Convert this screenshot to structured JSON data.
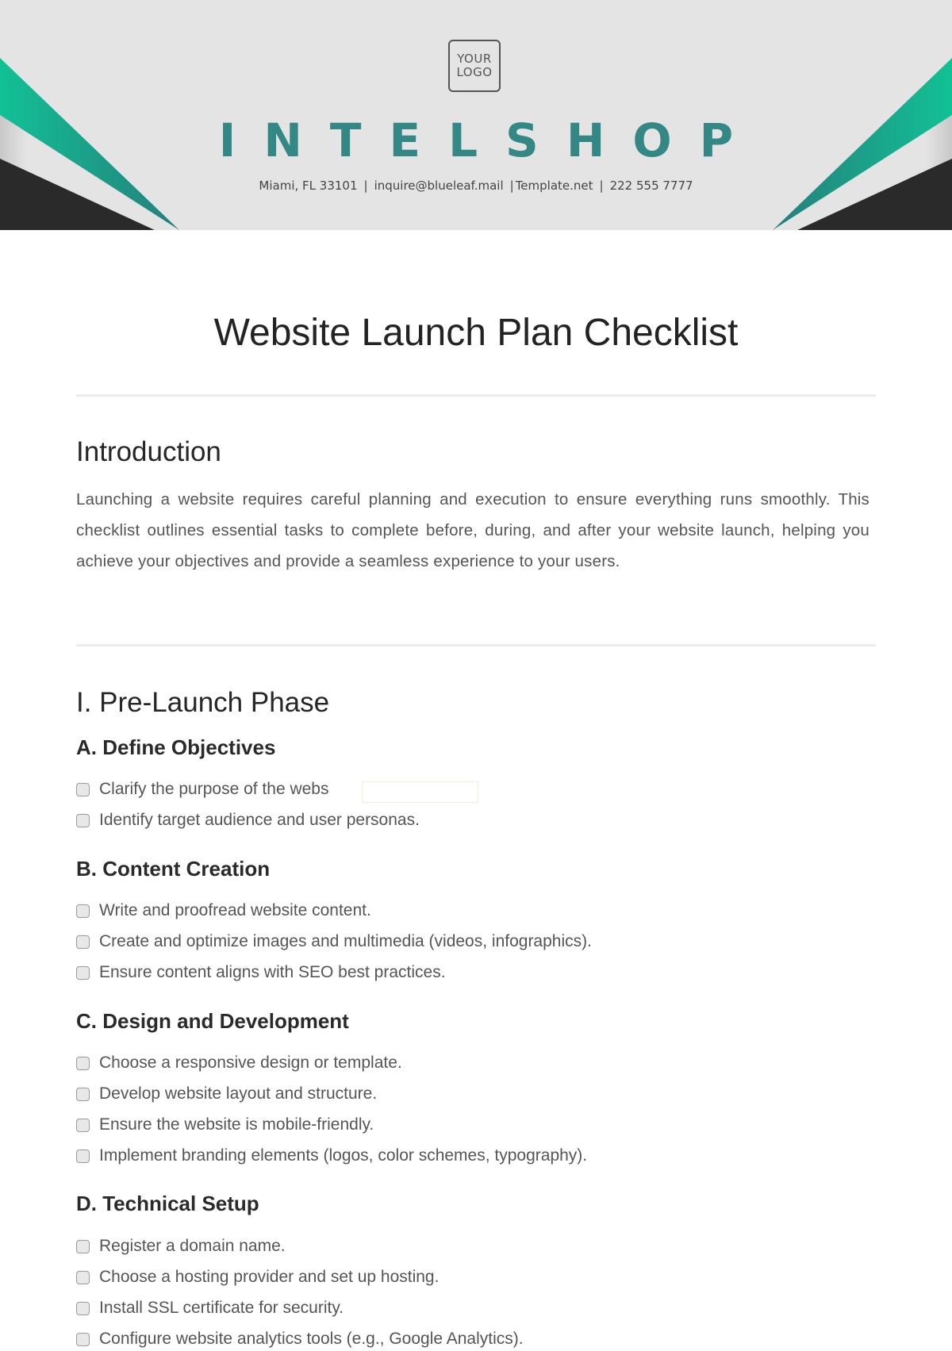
{
  "header": {
    "logo_line1": "YOUR",
    "logo_line2": "LOGO",
    "brand_name": "INTELSHOP",
    "contact": {
      "address": "Miami, FL 33101",
      "email": "inquire@blueleaf.mail",
      "website": "Template.net",
      "phone": "222 555 7777",
      "separator": "|"
    },
    "colors": {
      "background": "#e4e4e4",
      "brand_teal": "#338885",
      "accent_green": "#12c196",
      "accent_dark_teal": "#247f7c",
      "corner_dark": "#2a2a2a"
    }
  },
  "document": {
    "title": "Website Launch Plan Checklist",
    "introduction": {
      "heading": "Introduction",
      "body": "Launching a website requires careful planning and execution to ensure everything runs smoothly. This checklist outlines essential tasks to complete before, during, and after your website launch, helping you achieve your objectives and provide a seamless experience to your users."
    },
    "phase1": {
      "heading": "I. Pre-Launch Phase",
      "sections": [
        {
          "heading": "A. Define Objectives",
          "items": [
            {
              "label": "Clarify the purpose of the webs",
              "checked": false
            },
            {
              "label": "Identify target audience and user personas.",
              "checked": false
            }
          ]
        },
        {
          "heading": "B. Content Creation",
          "items": [
            {
              "label": "Write and proofread website content.",
              "checked": false
            },
            {
              "label": "Create and optimize images and multimedia (videos, infographics).",
              "checked": false
            },
            {
              "label": "Ensure content aligns with SEO best practices.",
              "checked": false
            }
          ]
        },
        {
          "heading": "C. Design and Development",
          "items": [
            {
              "label": "Choose a responsive design or template.",
              "checked": false
            },
            {
              "label": "Develop website layout and structure.",
              "checked": false
            },
            {
              "label": "Ensure the website is mobile-friendly.",
              "checked": false
            },
            {
              "label": "Implement branding elements (logos, color schemes, typography).",
              "checked": false
            }
          ]
        },
        {
          "heading": "D. Technical Setup",
          "items": [
            {
              "label": "Register a domain name.",
              "checked": false
            },
            {
              "label": "Choose a hosting provider and set up hosting.",
              "checked": false
            },
            {
              "label": "Install SSL certificate for security.",
              "checked": false
            },
            {
              "label": "Configure website analytics tools (e.g., Google Analytics).",
              "checked": false
            }
          ]
        }
      ]
    }
  }
}
